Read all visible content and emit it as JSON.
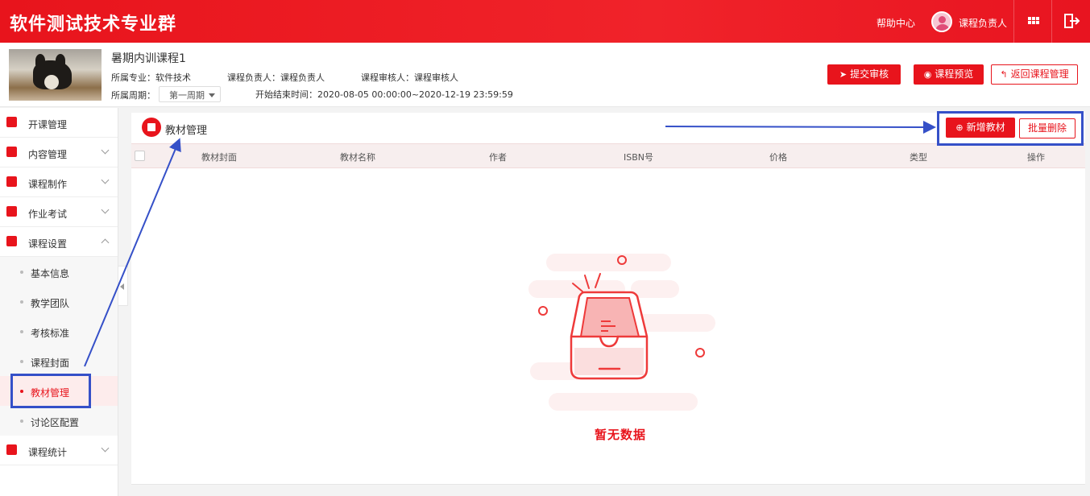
{
  "header": {
    "brand": "软件测试技术专业群",
    "help_label": "帮助中心",
    "user_name": "课程负责人"
  },
  "course": {
    "name": "暑期内训课程1",
    "major_label": "所属专业：软件技术",
    "owner_label": "课程负责人：课程负责人",
    "reviewer_label": "课程审核人：课程审核人",
    "period_label": "所属周期：",
    "period_value": "第一周期",
    "time_label": "开始结束时间：2020-08-05 00:00:00~2020-12-19 23:59:59",
    "submit_label": "提交审核",
    "preview_label": "课程预览",
    "back_label": "返回课程管理"
  },
  "sidebar": {
    "items": [
      {
        "label": "开课管理"
      },
      {
        "label": "内容管理"
      },
      {
        "label": "课程制作"
      },
      {
        "label": "作业考试"
      },
      {
        "label": "课程设置"
      }
    ],
    "sub_items": [
      {
        "label": "基本信息"
      },
      {
        "label": "教学团队"
      },
      {
        "label": "考核标准"
      },
      {
        "label": "课程封面"
      },
      {
        "label": "教材管理"
      },
      {
        "label": "讨论区配置"
      }
    ],
    "last_item": {
      "label": "课程统计"
    },
    "active_sub": "教材管理"
  },
  "main": {
    "title": "教材管理",
    "add_label": "新增教材",
    "batch_delete_label": "批量删除",
    "columns": [
      "教材封面",
      "教材名称",
      "作者",
      "ISBN号",
      "价格",
      "类型",
      "操作"
    ],
    "empty_text": "暂无数据"
  },
  "colors": {
    "accent": "#e8141c",
    "annotation": "#3550c8"
  }
}
